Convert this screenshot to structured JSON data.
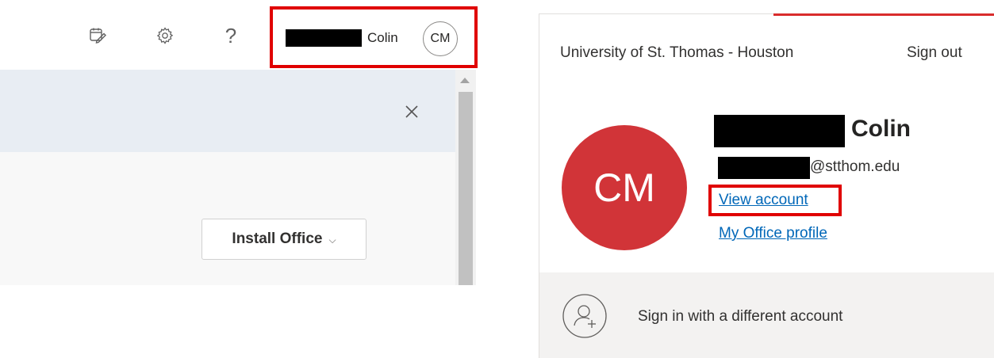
{
  "left_panel": {
    "account": {
      "display_name": "Colin",
      "initials": "CM"
    },
    "banner": {
      "close_icon": "close-icon"
    },
    "install_button": {
      "label": "Install Office",
      "chevron": "⌵"
    },
    "help_glyph": "?",
    "icons": [
      "calendar-check-icon",
      "gear-icon",
      "help-icon"
    ],
    "highlight_color": "#e00000"
  },
  "account_card": {
    "organization": "University of St. Thomas - Houston",
    "sign_out_label": "Sign out",
    "initials": "CM",
    "name": "Colin",
    "email_domain": "@stthom.edu",
    "view_account_label": "View account",
    "office_profile_label": "My Office profile",
    "switch_account_label": "Sign in with a different account",
    "avatar_color": "#d13438",
    "link_color": "#0067b8",
    "accent_color": "#d92c2c"
  }
}
